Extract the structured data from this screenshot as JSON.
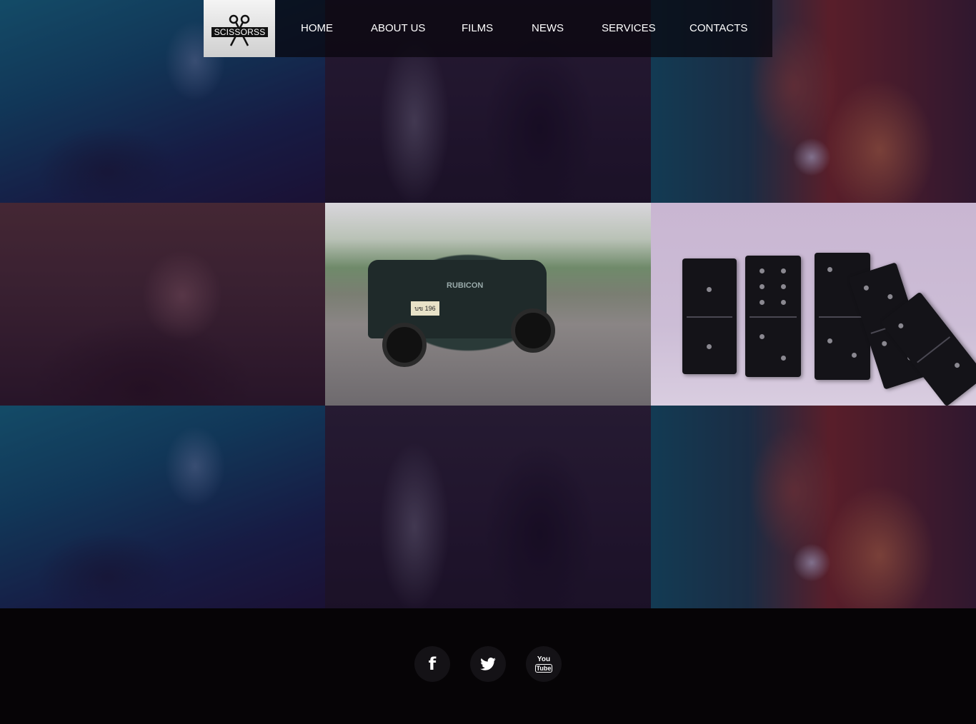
{
  "header": {
    "logo_text": "SCISSORSS",
    "nav": [
      {
        "label": "HOME"
      },
      {
        "label": "ABOUT US"
      },
      {
        "label": "FILMS"
      },
      {
        "label": "NEWS"
      },
      {
        "label": "SERVICES"
      },
      {
        "label": "CONTACTS"
      }
    ]
  },
  "gallery": {
    "tiles": [
      {
        "scene": "man-hand-raised-neon-blue"
      },
      {
        "scene": "man-pointing-statues"
      },
      {
        "scene": "woman-red-bokeh"
      },
      {
        "scene": "castle-on-cliff"
      },
      {
        "scene": "jeep-rubicon-road"
      },
      {
        "scene": "falling-dominoes"
      },
      {
        "scene": "man-hand-raised-neon-blue"
      },
      {
        "scene": "man-pointing-statues"
      },
      {
        "scene": "woman-red-bokeh"
      }
    ],
    "jeep_plate": "บข 196",
    "jeep_badge": "RUBICON"
  },
  "footer": {
    "social": [
      {
        "name": "facebook-icon",
        "glyph": "f"
      },
      {
        "name": "twitter-icon"
      },
      {
        "name": "youtube-icon",
        "top": "You",
        "bottom": "Tube"
      }
    ]
  },
  "colors": {
    "header_bg": "#0a080e",
    "footer_bg": "#060406",
    "nav_text": "#ffffff",
    "social_bg": "#141216"
  }
}
